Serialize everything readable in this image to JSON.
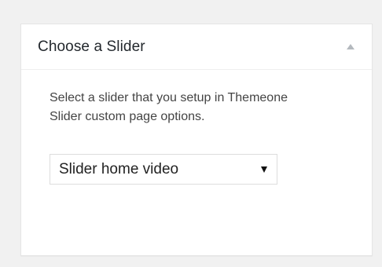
{
  "metabox": {
    "title": "Choose a Slider",
    "description": "Select a slider that you setup in Themeone Slider custom page options.",
    "toggle_icon": "triangle-up-icon"
  },
  "slider_select": {
    "selected": "Slider home video",
    "arrow_icon": "triangle-down-icon"
  },
  "colors": {
    "background": "#f1f1f1",
    "panel": "#ffffff",
    "border": "#e5e5e5",
    "toggle": "#b4b9be"
  }
}
